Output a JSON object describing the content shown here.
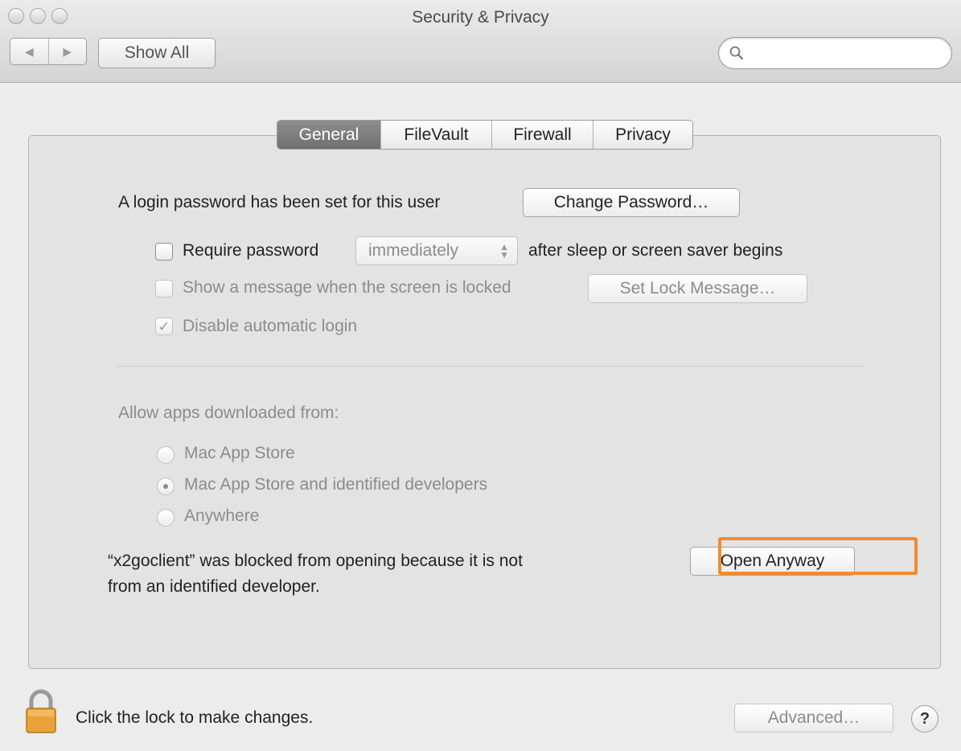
{
  "window": {
    "title": "Security & Privacy"
  },
  "toolbar": {
    "back_glyph": "◀",
    "forward_glyph": "▶",
    "show_all_label": "Show All",
    "search_placeholder": "",
    "search_icon": "magnifier-icon"
  },
  "tabs": [
    {
      "label": "General",
      "selected": true
    },
    {
      "label": "FileVault",
      "selected": false
    },
    {
      "label": "Firewall",
      "selected": false
    },
    {
      "label": "Privacy",
      "selected": false
    }
  ],
  "general": {
    "login_password_text": "A login password has been set for this user",
    "change_password_label": "Change Password…",
    "require_password": {
      "label": "Require password",
      "checked": false,
      "delay_value": "immediately",
      "suffix": "after sleep or screen saver begins"
    },
    "show_message": {
      "label": "Show a message when the screen is locked",
      "checked": false,
      "set_lock_message_label": "Set Lock Message…"
    },
    "disable_auto_login": {
      "label": "Disable automatic login",
      "checked": true,
      "check_glyph": "✓"
    },
    "allow_apps": {
      "heading": "Allow apps downloaded from:",
      "options": [
        {
          "label": "Mac App Store",
          "selected": false
        },
        {
          "label": "Mac App Store and identified developers",
          "selected": true
        },
        {
          "label": "Anywhere",
          "selected": false
        }
      ]
    },
    "blocked": {
      "line1": "“x2goclient” was blocked from opening because it is not",
      "line2": "from an identified developer.",
      "open_anyway_label": "Open Anyway"
    }
  },
  "footer": {
    "lock_text": "Click the lock to make changes.",
    "advanced_label": "Advanced…",
    "help_label": "?"
  },
  "colors": {
    "highlight": "#f28a2e",
    "selected_tab": "#7a7a7a",
    "lock_gold": "#e9a23b"
  }
}
